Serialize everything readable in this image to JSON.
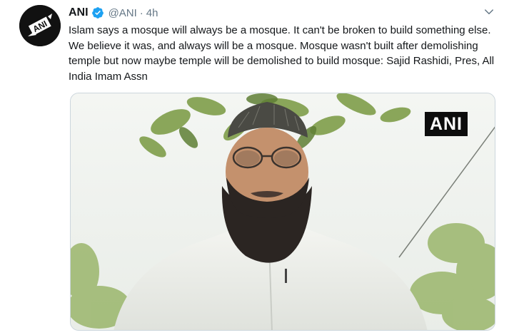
{
  "tweet": {
    "author": {
      "display_name": "ANI",
      "handle": "@ANI",
      "avatar_text": "ANI",
      "verified": true,
      "avatar_icon": "ani-logo-icon"
    },
    "separator": "·",
    "timestamp": "4h",
    "text": "Islam says a mosque will always be a mosque. It can't be broken to build something else. We believe it was, and always will be a mosque. Mosque wasn't built after demolishing temple but now maybe temple will be demolished to build mosque: Sajid Rashidi, Pres, All India Imam Assn",
    "media": {
      "type": "video-still",
      "watermark": "ANI"
    },
    "menu_icon": "chevron-down-icon"
  },
  "colors": {
    "text_primary": "#14171a",
    "text_secondary": "#657786",
    "verified_blue": "#1da1f2",
    "border": "#ccd6dd",
    "badge_bg": "#0d0d0d"
  }
}
